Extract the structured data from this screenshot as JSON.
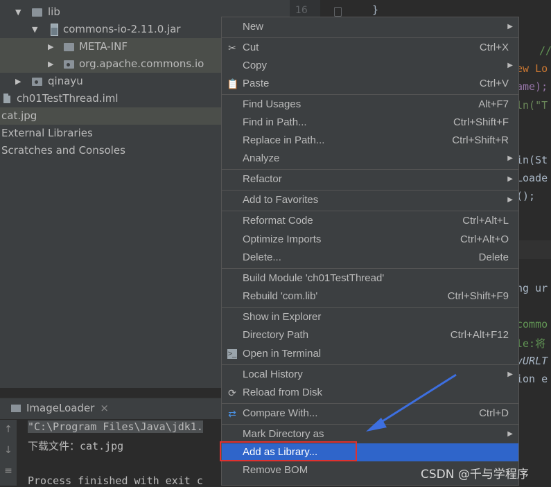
{
  "project_tree": {
    "items": [
      {
        "label": "lib",
        "expanded": true,
        "icon": "folder-icon"
      },
      {
        "label": "commons-io-2.11.0.jar",
        "expanded": true,
        "icon": "jar-icon"
      },
      {
        "label": "META-INF",
        "expanded": false,
        "icon": "folder-icon"
      },
      {
        "label": "org.apache.commons.io",
        "expanded": false,
        "icon": "package-icon"
      },
      {
        "label": "qinayu",
        "expanded": false,
        "icon": "package-icon"
      },
      {
        "label": "ch01TestThread.iml",
        "icon": "module-file-icon"
      },
      {
        "label": "cat.jpg"
      },
      {
        "label": "External Libraries"
      },
      {
        "label": "Scratches and Consoles"
      }
    ]
  },
  "editor": {
    "gutter_line": "16",
    "fragments": [
      "}",
      "//",
      "ew Lo",
      "ame);",
      "ln(\"T",
      "in(St",
      "Loade",
      "();",
      "ng ur",
      "commo",
      "le:将",
      "yURLT",
      "ion e"
    ]
  },
  "run_panel": {
    "tab_label": "ImageLoader",
    "tab_close": "×",
    "lines": [
      "\"C:\\Program Files\\Java\\jdk1.",
      "下载文件：cat.jpg",
      "",
      "Process finished with exit c"
    ]
  },
  "context_menu": {
    "items": [
      {
        "label": "New",
        "shortcut": "",
        "submenu": true
      },
      {
        "label": "Cut",
        "shortcut": "Ctrl+X",
        "icon": "scissors-icon"
      },
      {
        "label": "Copy",
        "shortcut": "",
        "submenu": true
      },
      {
        "label": "Paste",
        "shortcut": "Ctrl+V",
        "icon": "clipboard-icon"
      },
      {
        "label": "Find Usages",
        "shortcut": "Alt+F7"
      },
      {
        "label": "Find in Path...",
        "shortcut": "Ctrl+Shift+F"
      },
      {
        "label": "Replace in Path...",
        "shortcut": "Ctrl+Shift+R"
      },
      {
        "label": "Analyze",
        "shortcut": "",
        "submenu": true
      },
      {
        "label": "Refactor",
        "shortcut": "",
        "submenu": true
      },
      {
        "label": "Add to Favorites",
        "shortcut": "",
        "submenu": true
      },
      {
        "label": "Reformat Code",
        "shortcut": "Ctrl+Alt+L"
      },
      {
        "label": "Optimize Imports",
        "shortcut": "Ctrl+Alt+O"
      },
      {
        "label": "Delete...",
        "shortcut": "Delete"
      },
      {
        "label": "Build Module 'ch01TestThread'",
        "shortcut": ""
      },
      {
        "label": "Rebuild 'com.lib'",
        "shortcut": "Ctrl+Shift+F9"
      },
      {
        "label": "Show in Explorer",
        "shortcut": ""
      },
      {
        "label": "Directory Path",
        "shortcut": "Ctrl+Alt+F12"
      },
      {
        "label": "Open in Terminal",
        "shortcut": "",
        "icon": "terminal-icon"
      },
      {
        "label": "Local History",
        "shortcut": "",
        "submenu": true
      },
      {
        "label": "Reload from Disk",
        "shortcut": "",
        "icon": "reload-icon"
      },
      {
        "label": "Compare With...",
        "shortcut": "Ctrl+D",
        "icon": "compare-icon"
      },
      {
        "label": "Mark Directory as",
        "shortcut": "",
        "submenu": true
      },
      {
        "label": "Add as Library...",
        "shortcut": "",
        "selected": true
      },
      {
        "label": "Remove BOM",
        "shortcut": ""
      }
    ]
  },
  "watermark": "CSDN @千与学程序",
  "colors": {
    "selection": "#2f65ca",
    "highlight_box": "#e0312f",
    "annotation_arrow": "#3d6fe0",
    "panel_bg": "#3c3f41",
    "editor_bg": "#2b2b2b"
  }
}
